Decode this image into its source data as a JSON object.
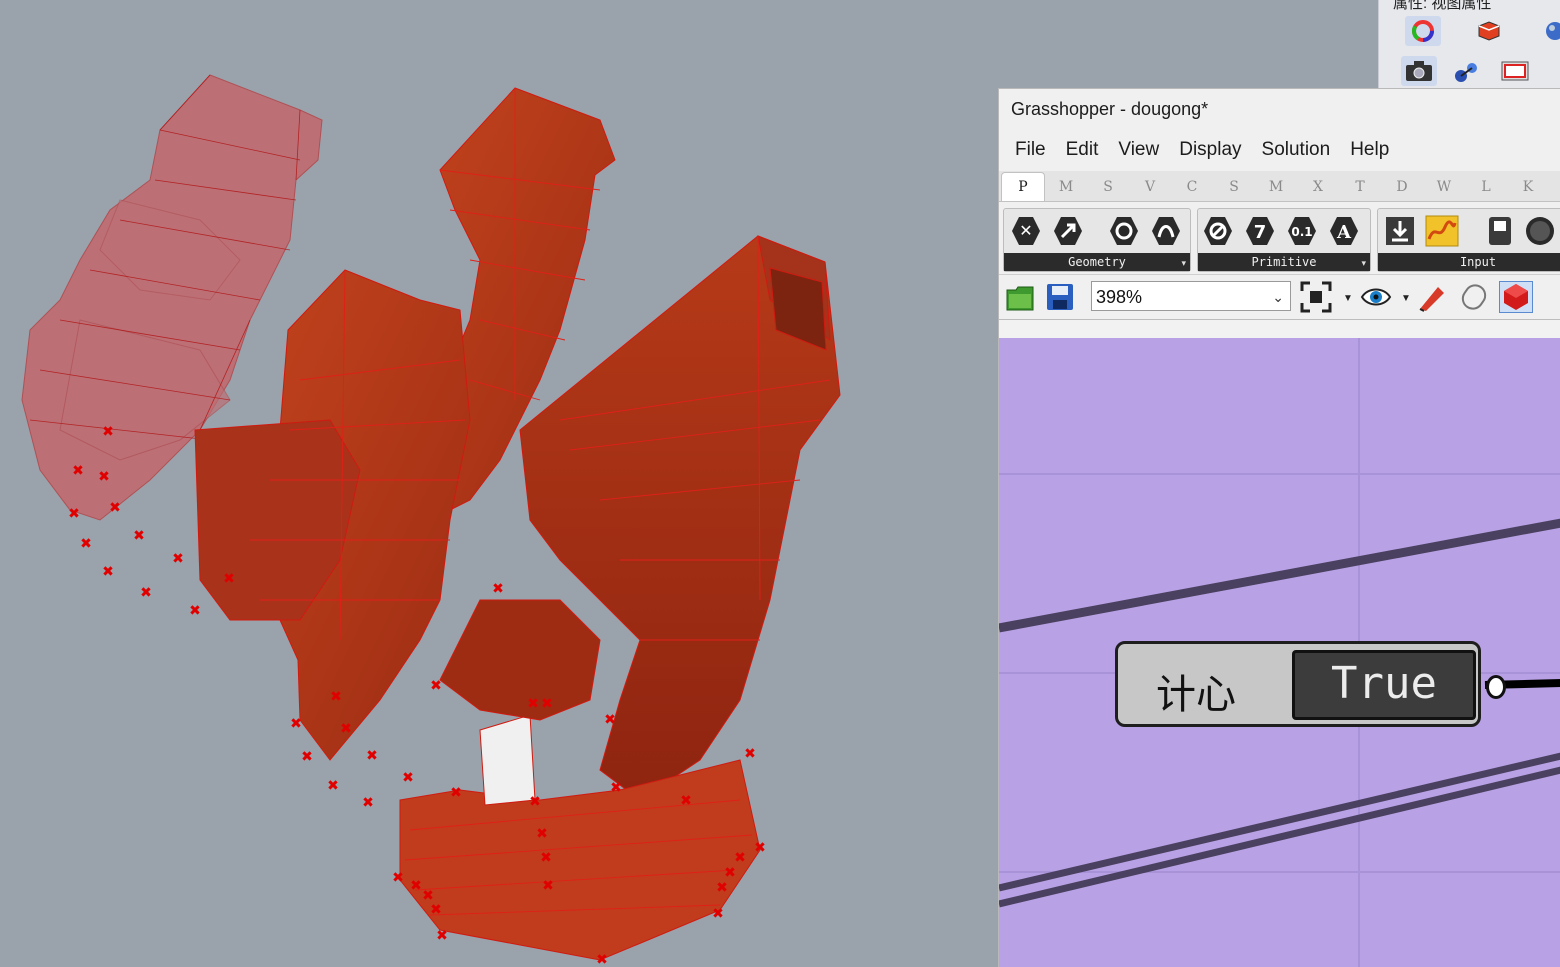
{
  "viewport": {
    "background": "#9aa2ab",
    "model_color": "#b93a1a",
    "ghost_color": "#d23a3a",
    "point_marker_color": "#e00000"
  },
  "props_panel": {
    "title": "属性: 视图属性",
    "icons": [
      "color-wheel-icon",
      "layer-icon",
      "material-sphere-icon",
      "camera-icon",
      "gumball-icon",
      "frame-icon"
    ]
  },
  "grasshopper": {
    "title": "Grasshopper - dougong*",
    "menu": [
      "File",
      "Edit",
      "View",
      "Display",
      "Solution",
      "Help"
    ],
    "tabs": [
      "P",
      "M",
      "S",
      "V",
      "C",
      "S",
      "M",
      "X",
      "T",
      "D",
      "W",
      "L",
      "K"
    ],
    "active_tab": "P",
    "ribbon_groups": [
      {
        "label": "Geometry",
        "glyphs": [
          "✕",
          "➚",
          "◯",
          "∿"
        ]
      },
      {
        "label": "Primitive",
        "glyphs": [
          "⊘",
          "7",
          "0.1",
          "A"
        ]
      },
      {
        "label": "Input",
        "glyphs": [
          "⇩",
          "∿",
          "▮",
          "●"
        ]
      }
    ],
    "zoom": "398%",
    "canvas_color": "#b8a1e4",
    "toggle": {
      "label": "计心",
      "value": "True"
    }
  }
}
